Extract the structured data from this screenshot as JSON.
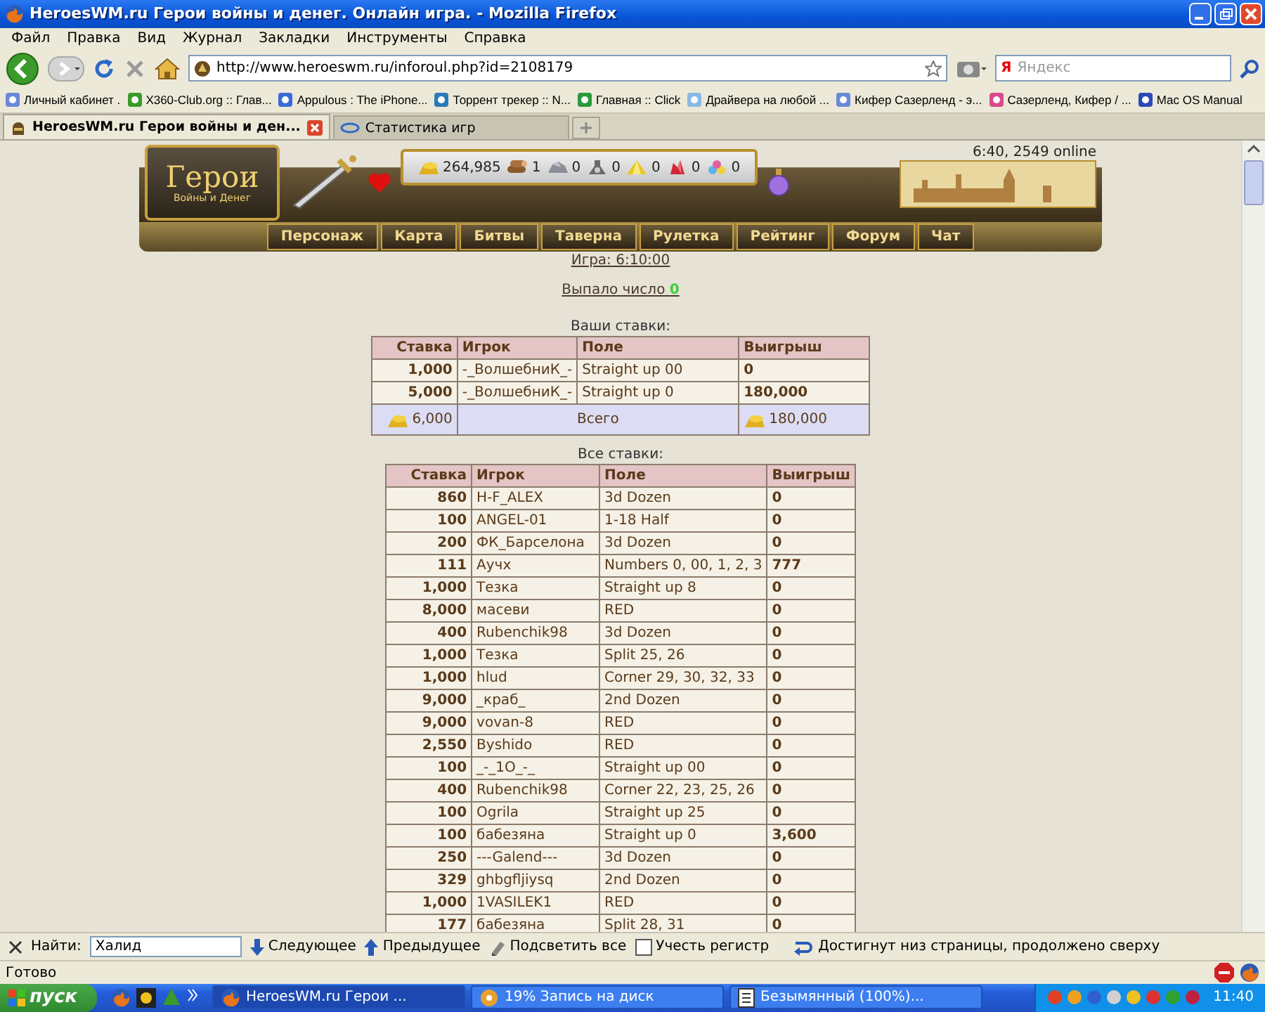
{
  "window": {
    "title": "HeroesWM.ru Герои войны и денег. Онлайн игра. - Mozilla Firefox"
  },
  "menu": [
    "Файл",
    "Правка",
    "Вид",
    "Журнал",
    "Закладки",
    "Инструменты",
    "Справка"
  ],
  "toolbar": {
    "url": "http://www.heroeswm.ru/inforoul.php?id=2108179",
    "search_logo": "Я",
    "search_placeholder": "Яндекс"
  },
  "bookmarks": [
    "Личный кабинет .",
    "X360-Club.org :: Глав...",
    "Appulous : The iPhone...",
    "Торрент трекер :: N...",
    "Главная :: Click",
    "Драйвера на любой ...",
    "Кифер Сазерленд - э...",
    "Сазерленд, Кифер / ...",
    "Mac OS Manual"
  ],
  "tabs": [
    {
      "label": "HeroesWM.ru Герои войны и ден...",
      "selected": true
    },
    {
      "label": "Статистика игр",
      "selected": false
    }
  ],
  "game_header": {
    "logo_title": "Герои",
    "logo_subtitle": "Войны и Денег",
    "online": "6:40, 2549 online",
    "resources": [
      {
        "kind": "gold",
        "value": "264,985"
      },
      {
        "kind": "wood",
        "value": "1"
      },
      {
        "kind": "ore",
        "value": "0"
      },
      {
        "kind": "mercury",
        "value": "0"
      },
      {
        "kind": "sulfur",
        "value": "0"
      },
      {
        "kind": "crystals",
        "value": "0"
      },
      {
        "kind": "gems",
        "value": "0"
      }
    ],
    "nav": [
      "Персонаж",
      "Карта",
      "Битвы",
      "Таверна",
      "Рулетка",
      "Рейтинг",
      "Форум",
      "Чат"
    ]
  },
  "game_link": "Игра: 6:10:00",
  "result": {
    "label": "Выпало число",
    "number": "0"
  },
  "your_bets": {
    "caption": "Ваши ставки:",
    "columns": [
      "Ставка",
      "Игрок",
      "Поле",
      "Выигрыш"
    ],
    "rows": [
      [
        "1,000",
        "-_ВолшебниК_-",
        "Straight up 00",
        "0"
      ],
      [
        "5,000",
        "-_ВолшебниК_-",
        "Straight up 0",
        "180,000"
      ]
    ],
    "total": {
      "stake": "6,000",
      "label": "Всего",
      "win": "180,000"
    }
  },
  "all_bets": {
    "caption": "Все ставки:",
    "columns": [
      "Ставка",
      "Игрок",
      "Поле",
      "Выигрыш"
    ],
    "rows": [
      [
        "860",
        "H-F_ALEX",
        "3d Dozen",
        "0"
      ],
      [
        "100",
        "ANGEL-01",
        "1-18 Half",
        "0"
      ],
      [
        "200",
        "ФК_Барселона",
        "3d Dozen",
        "0"
      ],
      [
        "111",
        "Аучх",
        "Numbers 0, 00, 1, 2, 3",
        "777"
      ],
      [
        "1,000",
        "Тезка",
        "Straight up 8",
        "0"
      ],
      [
        "8,000",
        "масеви",
        "RED",
        "0"
      ],
      [
        "400",
        "Rubenchik98",
        "3d Dozen",
        "0"
      ],
      [
        "1,000",
        "Тезка",
        "Split 25, 26",
        "0"
      ],
      [
        "1,000",
        "hlud",
        "Corner 29, 30, 32, 33",
        "0"
      ],
      [
        "9,000",
        "_краб_",
        "2nd Dozen",
        "0"
      ],
      [
        "9,000",
        "vovan-8",
        "RED",
        "0"
      ],
      [
        "2,550",
        "Byshido",
        "RED",
        "0"
      ],
      [
        "100",
        "_-_1O_-_",
        "Straight up 00",
        "0"
      ],
      [
        "400",
        "Rubenchik98",
        "Corner 22, 23, 25, 26",
        "0"
      ],
      [
        "100",
        "Ogrila",
        "Straight up 25",
        "0"
      ],
      [
        "100",
        "бабезяна",
        "Straight up 0",
        "3,600"
      ],
      [
        "250",
        "---Galend---",
        "3d Dozen",
        "0"
      ],
      [
        "329",
        "ghbgfljiysq",
        "2nd Dozen",
        "0"
      ],
      [
        "1,000",
        "1VASILEK1",
        "RED",
        "0"
      ],
      [
        "177",
        "бабезяна",
        "Split 28, 31",
        "0"
      ]
    ]
  },
  "find_bar": {
    "label": "Найти:",
    "value": "Халид",
    "next": "Следующее",
    "previous": "Предыдущее",
    "highlight": "Подсветить все",
    "match_case": {
      "label": "Учесть регистр",
      "checked": false
    },
    "message": "Достигнут низ страницы, продолжено сверху"
  },
  "status_bar": "Готово",
  "taskbar": {
    "start": "пуск",
    "tasks": [
      {
        "label": "HeroesWM.ru Герои ...",
        "selected": true
      },
      {
        "label": "19% Запись на диск",
        "selected": false
      },
      {
        "label": "Безымянный (100%)...",
        "selected": false
      }
    ],
    "clock": "11:40"
  }
}
